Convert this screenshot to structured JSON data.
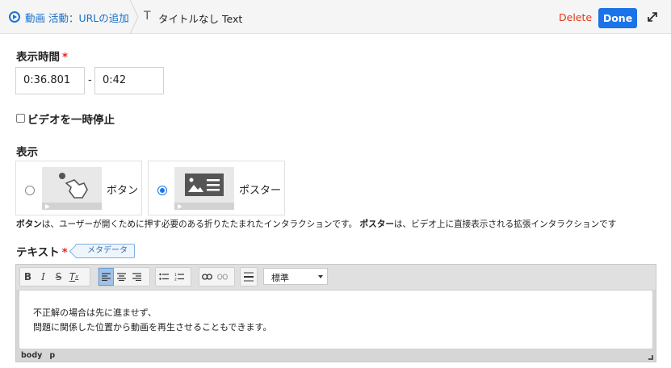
{
  "header": {
    "breadcrumb": "動画 活動：URLの追加",
    "title": "タイトルなし Text",
    "delete_label": "Delete",
    "done_label": "Done",
    "colors": {
      "accent": "#1a73e8",
      "delete": "#e03a1e"
    }
  },
  "form": {
    "time_label": "表示時間",
    "required_mark": "*",
    "start_time": "0:36.801",
    "time_separator": "-",
    "end_time": "0:42",
    "pause_label": "ビデオを一時停止",
    "pause_checked": false,
    "display_label": "表示",
    "options": [
      {
        "label": "ボタン",
        "selected": false,
        "thumb_icon": "touch-icon"
      },
      {
        "label": "ポスター",
        "selected": true,
        "thumb_icon": "poster-icon"
      }
    ],
    "description": {
      "part1_bold": "ボタン",
      "part1": "は、ユーザーが開くために押す必要のある折りたたまれたインタラクションです。",
      "part2_bold": "ポスター",
      "part2": "は、ビデオ上に直接表示される拡張インタラクションです"
    },
    "text_label": "テキスト",
    "meta_badge": "メタデータ"
  },
  "editor": {
    "format_select": "標準",
    "lines": [
      "不正解の場合は先に進ませず、",
      "問題に関係した位置から動画を再生させることもできます。"
    ],
    "status_path": [
      "body",
      "p"
    ]
  }
}
